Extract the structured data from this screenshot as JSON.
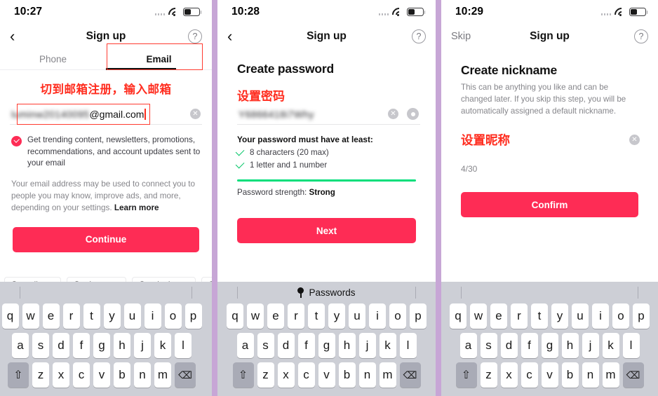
{
  "accent": "#fe2c55",
  "annotation_color": "#ff2d1f",
  "green": "#00de7a",
  "panels": [
    {
      "status": {
        "time": "10:27",
        "wifi_icon": "wifi-icon",
        "battery_icon": "battery-icon",
        "signal_icon": "signal-dots-icon"
      },
      "nav": {
        "back_icon": "chevron-left-icon",
        "title": "Sign up",
        "help_icon": "question-mark-circle-icon"
      },
      "tabs": [
        {
          "label": "Phone",
          "active": false
        },
        {
          "label": "Email",
          "active": true
        }
      ],
      "annotation": "切到邮箱注册，输入邮箱",
      "email_field": {
        "blurred_value": "luminw20140095",
        "visible_value": "@gmail.com",
        "clear_icon": "clear-circle-icon"
      },
      "consent": {
        "checkbox_icon": "checkmark-circle-filled-icon",
        "checked": true,
        "text": "Get trending content, newsletters, promotions, recommendations, and account updates sent to your email"
      },
      "legal_text": "Your email address may be used to connect you to people you may know, improve ads, and more, depending on your settings.",
      "legal_link": "Learn more",
      "primary_button": "Continue",
      "suggestions": [
        "@gmail.com",
        "@yahoo.com",
        "@outlook.com",
        "@"
      ],
      "keyboard": {
        "top_label": "",
        "row1": [
          "q",
          "w",
          "e",
          "r",
          "t",
          "y",
          "u",
          "i",
          "o",
          "p"
        ],
        "row2": [
          "a",
          "s",
          "d",
          "f",
          "g",
          "h",
          "j",
          "k",
          "l"
        ],
        "row3": [
          "z",
          "x",
          "c",
          "v",
          "b",
          "n",
          "m"
        ],
        "shift_icon": "shift-up-arrow-icon",
        "backspace_icon": "backspace-delete-icon"
      }
    },
    {
      "status": {
        "time": "10:28",
        "wifi_icon": "wifi-icon",
        "battery_icon": "battery-icon",
        "signal_icon": "signal-dots-icon"
      },
      "nav": {
        "back_icon": "chevron-left-icon",
        "title": "Sign up",
        "help_icon": "question-mark-circle-icon"
      },
      "heading": "Create password",
      "annotation": "设置密码",
      "password_field": {
        "blurred_value": "Y6866418i7Why",
        "clear_icon": "clear-circle-icon",
        "reveal_icon": "eye-show-password-icon"
      },
      "rules_heading": "Your password must have at least:",
      "rules": [
        {
          "label": "8 characters (20 max)",
          "met": true
        },
        {
          "label": "1 letter and 1 number",
          "met": true
        }
      ],
      "strength_label": "Password strength:",
      "strength_value": "Strong",
      "strength_percent": 100,
      "primary_button": "Next",
      "keyboard": {
        "top_label": "Passwords",
        "top_icon": "key-icon",
        "row1": [
          "q",
          "w",
          "e",
          "r",
          "t",
          "y",
          "u",
          "i",
          "o",
          "p"
        ],
        "row2": [
          "a",
          "s",
          "d",
          "f",
          "g",
          "h",
          "j",
          "k",
          "l"
        ],
        "row3": [
          "z",
          "x",
          "c",
          "v",
          "b",
          "n",
          "m"
        ],
        "shift_icon": "shift-up-arrow-icon",
        "backspace_icon": "backspace-delete-icon"
      }
    },
    {
      "status": {
        "time": "10:29",
        "wifi_icon": "wifi-icon",
        "battery_icon": "battery-icon",
        "signal_icon": "signal-dots-icon"
      },
      "nav": {
        "skip_label": "Skip",
        "title": "Sign up",
        "help_icon": "question-mark-circle-icon"
      },
      "heading": "Create nickname",
      "subtitle": "This can be anything you like and can be changed later. If you skip this step, you will be automatically assigned a default nickname.",
      "nickname_field": {
        "value": "设置昵称",
        "clear_icon": "clear-circle-icon"
      },
      "counter": "4/30",
      "primary_button": "Confirm",
      "keyboard": {
        "top_label": "",
        "row1": [
          "q",
          "w",
          "e",
          "r",
          "t",
          "y",
          "u",
          "i",
          "o",
          "p"
        ],
        "row2": [
          "a",
          "s",
          "d",
          "f",
          "g",
          "h",
          "j",
          "k",
          "l"
        ],
        "row3": [
          "z",
          "x",
          "c",
          "v",
          "b",
          "n",
          "m"
        ],
        "shift_icon": "shift-up-arrow-icon",
        "backspace_icon": "backspace-delete-icon"
      }
    }
  ]
}
